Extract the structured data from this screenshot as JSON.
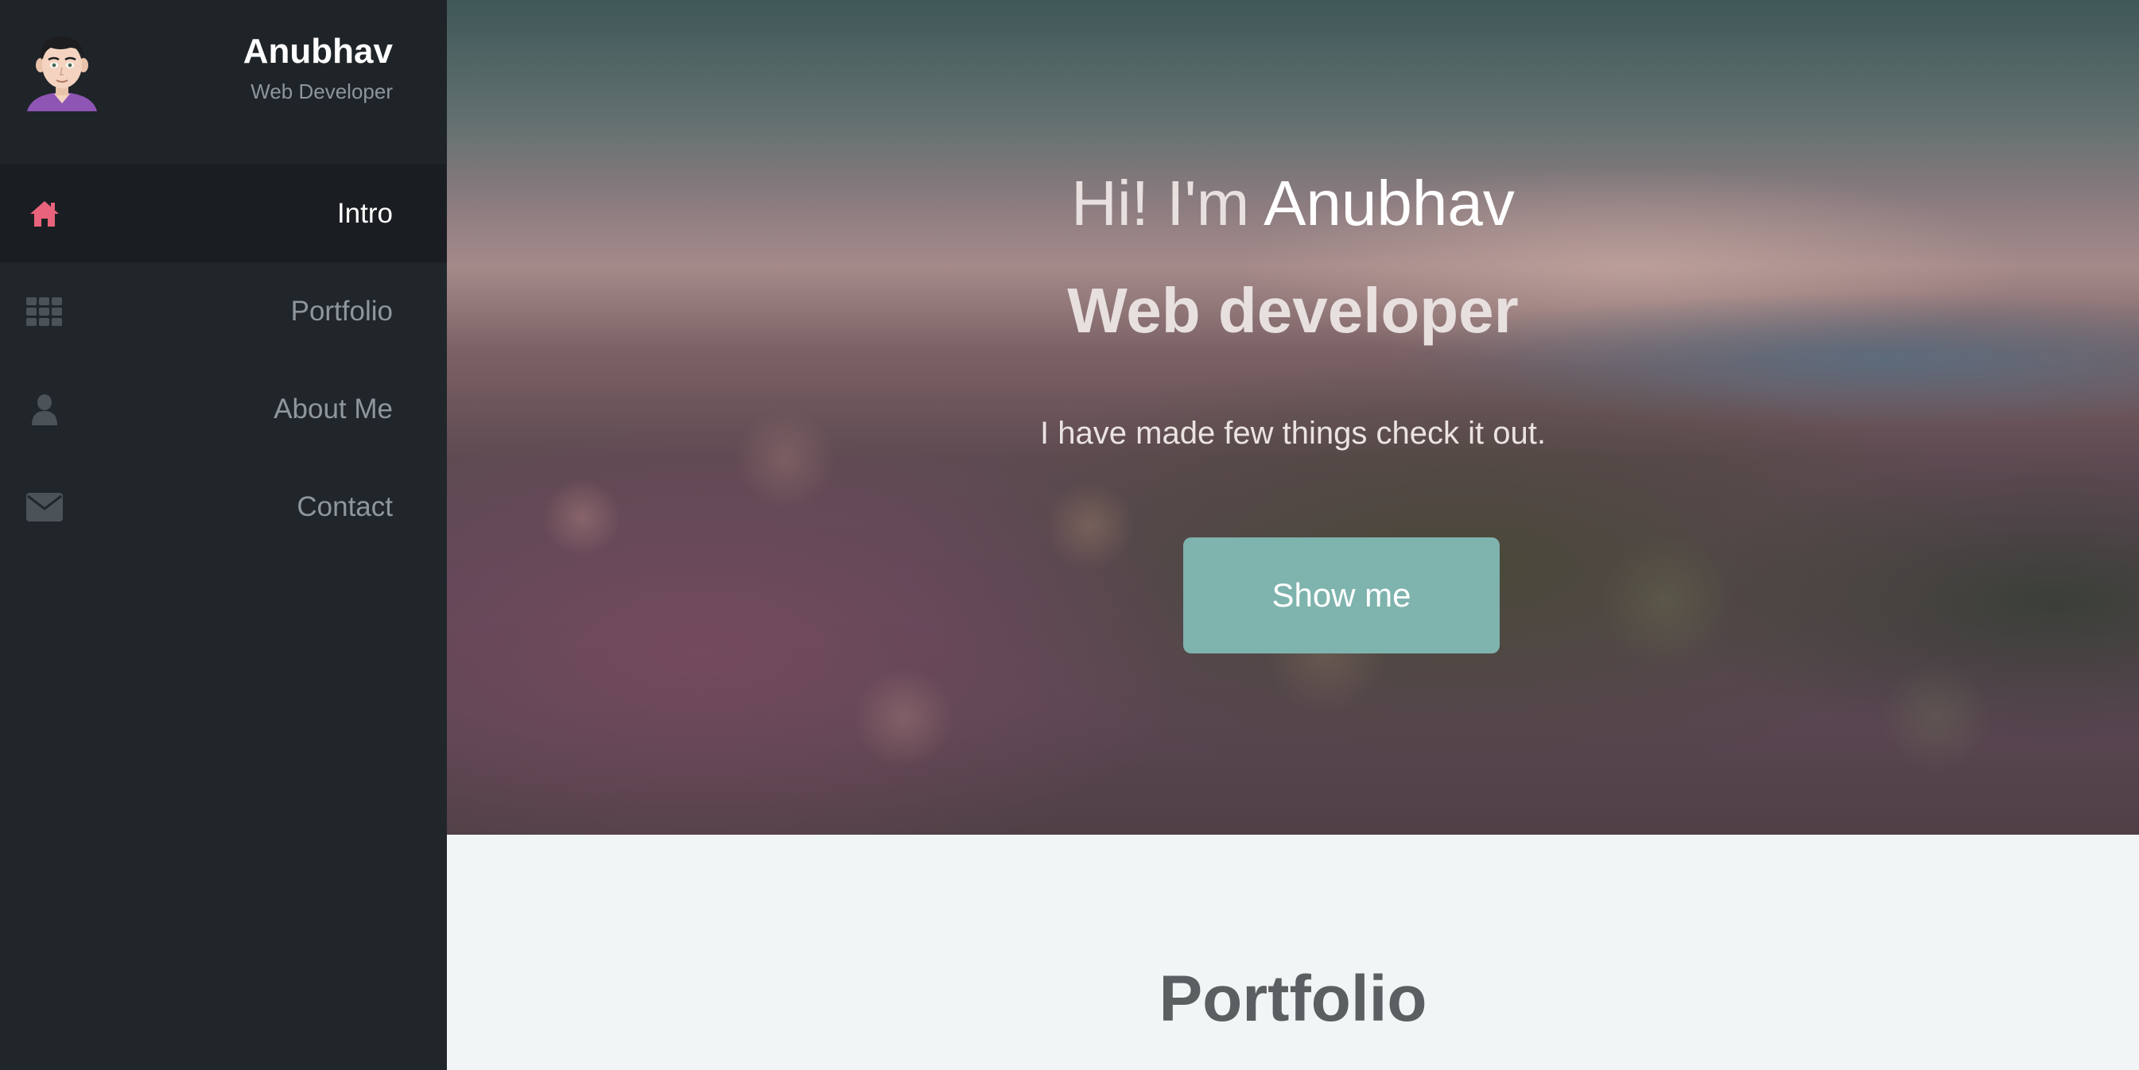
{
  "profile": {
    "name": "Anubhav",
    "role": "Web Developer"
  },
  "nav": {
    "items": [
      {
        "label": "Intro",
        "icon": "home-icon",
        "active": true
      },
      {
        "label": "Portfolio",
        "icon": "grid-icon",
        "active": false
      },
      {
        "label": "About Me",
        "icon": "user-icon",
        "active": false
      },
      {
        "label": "Contact",
        "icon": "envelope-icon",
        "active": false
      }
    ]
  },
  "hero": {
    "greeting": "Hi! I'm ",
    "name": "Anubhav",
    "subtitle": "Web developer",
    "tagline": "I have made few things check it out.",
    "cta_label": "Show me"
  },
  "portfolio": {
    "title": "Portfolio"
  },
  "colors": {
    "sidebar_bg": "#21262b",
    "active_icon": "#e8637b",
    "inactive_icon": "#4c5358",
    "cta_bg": "#7fb3ae"
  }
}
